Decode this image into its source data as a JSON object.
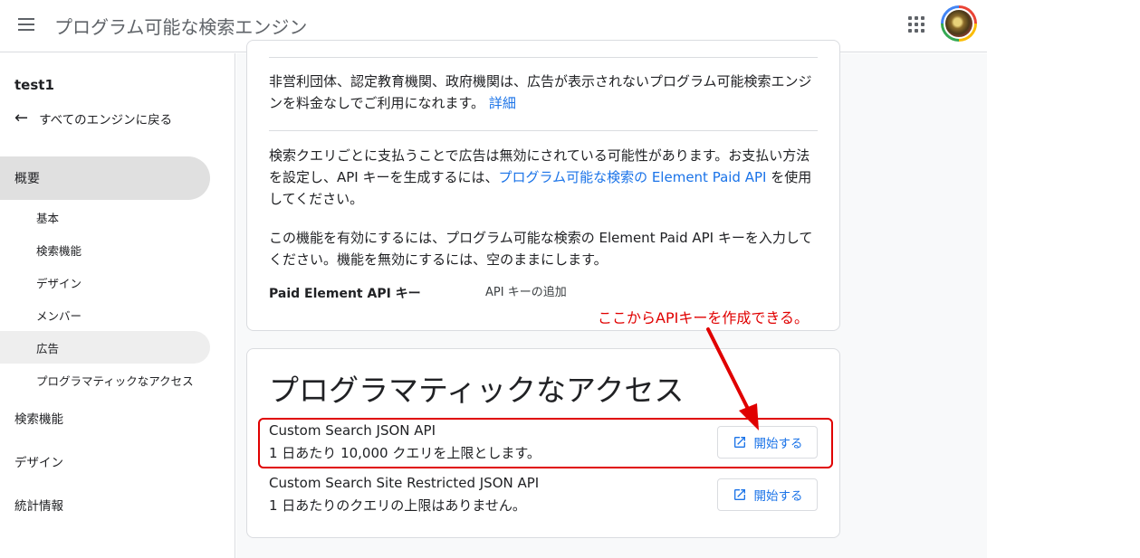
{
  "header": {
    "title": "プログラム可能な検索エンジン"
  },
  "sidebar": {
    "engine_name": "test1",
    "back_label": "すべてのエンジンに戻る",
    "overview": "概要",
    "sub_items": [
      "基本",
      "検索機能",
      "デザイン",
      "メンバー",
      "広告",
      "プログラマティックなアクセス"
    ],
    "main_items": [
      "検索機能",
      "デザイン",
      "統計情報"
    ]
  },
  "ads_card": {
    "nonprofit_text": "非営利団体、認定教育機関、政府機関は、広告が表示されないプログラム可能検索エンジンを料金なしでご利用になれます。",
    "nonprofit_link": "詳細",
    "paid_text_before": "検索クエリごとに支払うことで広告は無効にされている可能性があります。お支払い方法を設定し、API キーを生成するには、",
    "paid_link": "プログラム可能な検索の Element Paid API",
    "paid_text_after": " を使用してください。",
    "enable_text": "この機能を有効にするには、プログラム可能な検索の Element Paid API キーを入力してください。機能を無効にするには、空のままにします。",
    "api_key_label": "Paid Element API キー",
    "api_key_add": "API キーの追加"
  },
  "access_card": {
    "title": "プログラマティックなアクセス",
    "apis": [
      {
        "name": "Custom Search JSON API",
        "desc": "1 日あたり 10,000 クエリを上限とします。",
        "button": "開始する"
      },
      {
        "name": "Custom Search Site Restricted JSON API",
        "desc": "1 日あたりのクエリの上限はありません。",
        "button": "開始する"
      }
    ]
  },
  "annotation": {
    "text": "ここからAPIキーを作成できる。",
    "color": "#e00000"
  },
  "colors": {
    "accent": "#1a73e8",
    "nav_active": "#e0e0e0"
  }
}
